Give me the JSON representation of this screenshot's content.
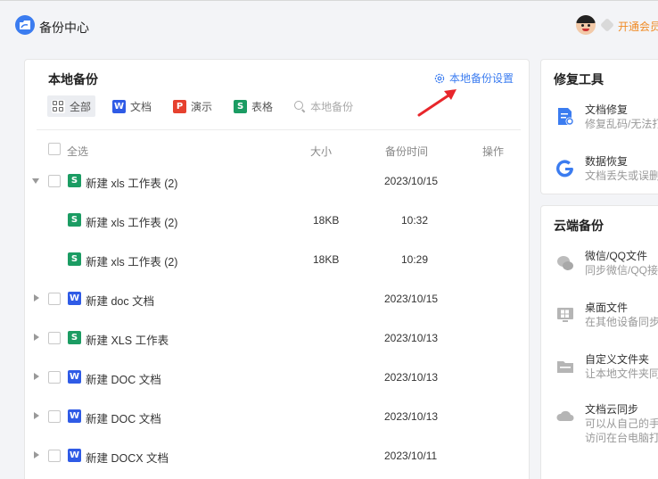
{
  "app": {
    "title": "备份中心",
    "vip_label": "开通会员"
  },
  "local": {
    "title": "本地备份",
    "settings_label": "本地备份设置",
    "filters": [
      {
        "label": "全部",
        "icon": "grid-icon"
      },
      {
        "label": "文档",
        "icon": "W"
      },
      {
        "label": "演示",
        "icon": "P"
      },
      {
        "label": "表格",
        "icon": "S"
      }
    ],
    "search_placeholder": "本地备份",
    "columns": {
      "select_all": "全选",
      "size": "大小",
      "time": "备份时间",
      "action": "操作"
    },
    "rows": [
      {
        "icon": "S",
        "name": "新建 xls 工作表 (2)",
        "size": "",
        "time": "2023/10/15",
        "expanded": true
      },
      {
        "icon": "S",
        "name": "新建 xls 工作表 (2)",
        "size": "18KB",
        "time": "10:32"
      },
      {
        "icon": "S",
        "name": "新建 xls 工作表 (2)",
        "size": "18KB",
        "time": "10:29"
      },
      {
        "icon": "W",
        "name": "新建 doc 文档",
        "size": "",
        "time": "2023/10/15"
      },
      {
        "icon": "S",
        "name": "新建 XLS 工作表",
        "size": "",
        "time": "2023/10/13"
      },
      {
        "icon": "W",
        "name": "新建 DOC 文档",
        "size": "",
        "time": "2023/10/13"
      },
      {
        "icon": "W",
        "name": "新建 DOC 文档",
        "size": "",
        "time": "2023/10/13"
      },
      {
        "icon": "W",
        "name": "新建 DOCX 文档",
        "size": "",
        "time": "2023/10/11"
      }
    ]
  },
  "repair": {
    "title": "修复工具",
    "items": [
      {
        "name": "文档修复",
        "desc": "修复乱码/无法打"
      },
      {
        "name": "数据恢复",
        "desc": "文档丢失或误删"
      }
    ]
  },
  "cloud": {
    "title": "云端备份",
    "items": [
      {
        "name": "微信/QQ文件",
        "desc": "同步微信/QQ接"
      },
      {
        "name": "桌面文件",
        "desc": "在其他设备同步"
      },
      {
        "name": "自定义文件夹",
        "desc": "让本地文件夹同"
      },
      {
        "name": "文档云同步",
        "desc": "可以从自己的手",
        "desc2": "访问在台电脑打"
      }
    ]
  },
  "colors": {
    "accent": "#3b7cf0",
    "vip": "#f08a24",
    "word": "#2f5be6",
    "ppt": "#e6412f",
    "sheet": "#1b9c63"
  }
}
